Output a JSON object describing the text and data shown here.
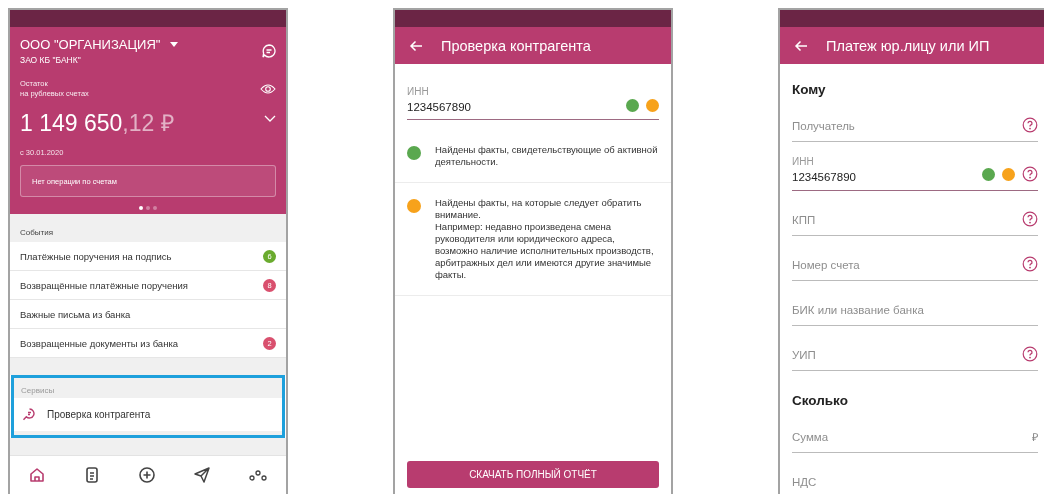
{
  "dashboard": {
    "organization": "ООО \"ОРГАНИЗАЦИЯ\"",
    "bank": "ЗАО КБ \"БАНК\"",
    "balance_label": "Остаток\nна рублевых счетах",
    "amount_integer": "1 149 650",
    "amount_fraction": ",12 ₽",
    "date": "с 30.01.2020",
    "operations_note": "Нет операции по счетам",
    "pager": [
      {
        "selected": true
      },
      {
        "selected": false
      },
      {
        "selected": false
      }
    ],
    "events": {
      "title": "События",
      "items": [
        {
          "label": "Платёжные поручения на подпись",
          "badge": "6",
          "color": "#6aab2e"
        },
        {
          "label": "Возвращённые платёжные поручения",
          "badge": "8",
          "color": "#d9506e"
        },
        {
          "label": "Важные письма из банка"
        },
        {
          "label": "Возвращенные документы из банка",
          "badge": "2",
          "color": "#d9506e"
        }
      ]
    },
    "services": {
      "title": "Сервисы",
      "highlighted": true,
      "items": [
        {
          "label": "Проверка контрагента"
        }
      ]
    },
    "nav": [
      {
        "kind": "home",
        "selected": true
      },
      {
        "kind": "document",
        "selected": false
      },
      {
        "kind": "plus",
        "selected": false
      },
      {
        "kind": "send",
        "selected": false
      },
      {
        "kind": "more",
        "selected": false
      }
    ]
  },
  "check": {
    "title": "Проверка контрагента",
    "field": {
      "label": "ИНН",
      "value": "1234567890",
      "indicators": [
        {
          "color": "#5aa84f"
        },
        {
          "color": "#f7a21b"
        }
      ]
    },
    "findings": [
      {
        "color": "#5aa84f",
        "text": "Найдены факты, свидетельствующие об активной деятельности."
      },
      {
        "color": "#f7a21b",
        "text": "Найдены факты, на которые следует обратить внимание.\nНапример: недавно произведена смена руководителя или юридического адреса, возможно наличие исполнительных производств, арбитражных дел или имеются другие значимые факты."
      }
    ],
    "button": "СКАЧАТЬ ПОЛНЫЙ ОТЧЁТ"
  },
  "payment": {
    "title": "Платеж юр.лицу или ИП",
    "sections": [
      {
        "title": "Кому",
        "fields": [
          {
            "label": "Получатель",
            "help": true
          },
          {
            "label": "ИНН",
            "value": "1234567890",
            "help": true,
            "indicators": [
              {
                "color": "#5aa84f"
              },
              {
                "color": "#f7a21b"
              }
            ]
          },
          {
            "label": "КПП",
            "help": true
          },
          {
            "label": "Номер счета",
            "help": true
          },
          {
            "label": "БИК или название банка",
            "help": false
          },
          {
            "label": "УИП",
            "help": true
          }
        ]
      },
      {
        "title": "Сколько",
        "fields": [
          {
            "label": "Сумма",
            "help": false,
            "suffix": "₽"
          },
          {
            "label": "НДС",
            "help": false
          }
        ]
      }
    ]
  }
}
